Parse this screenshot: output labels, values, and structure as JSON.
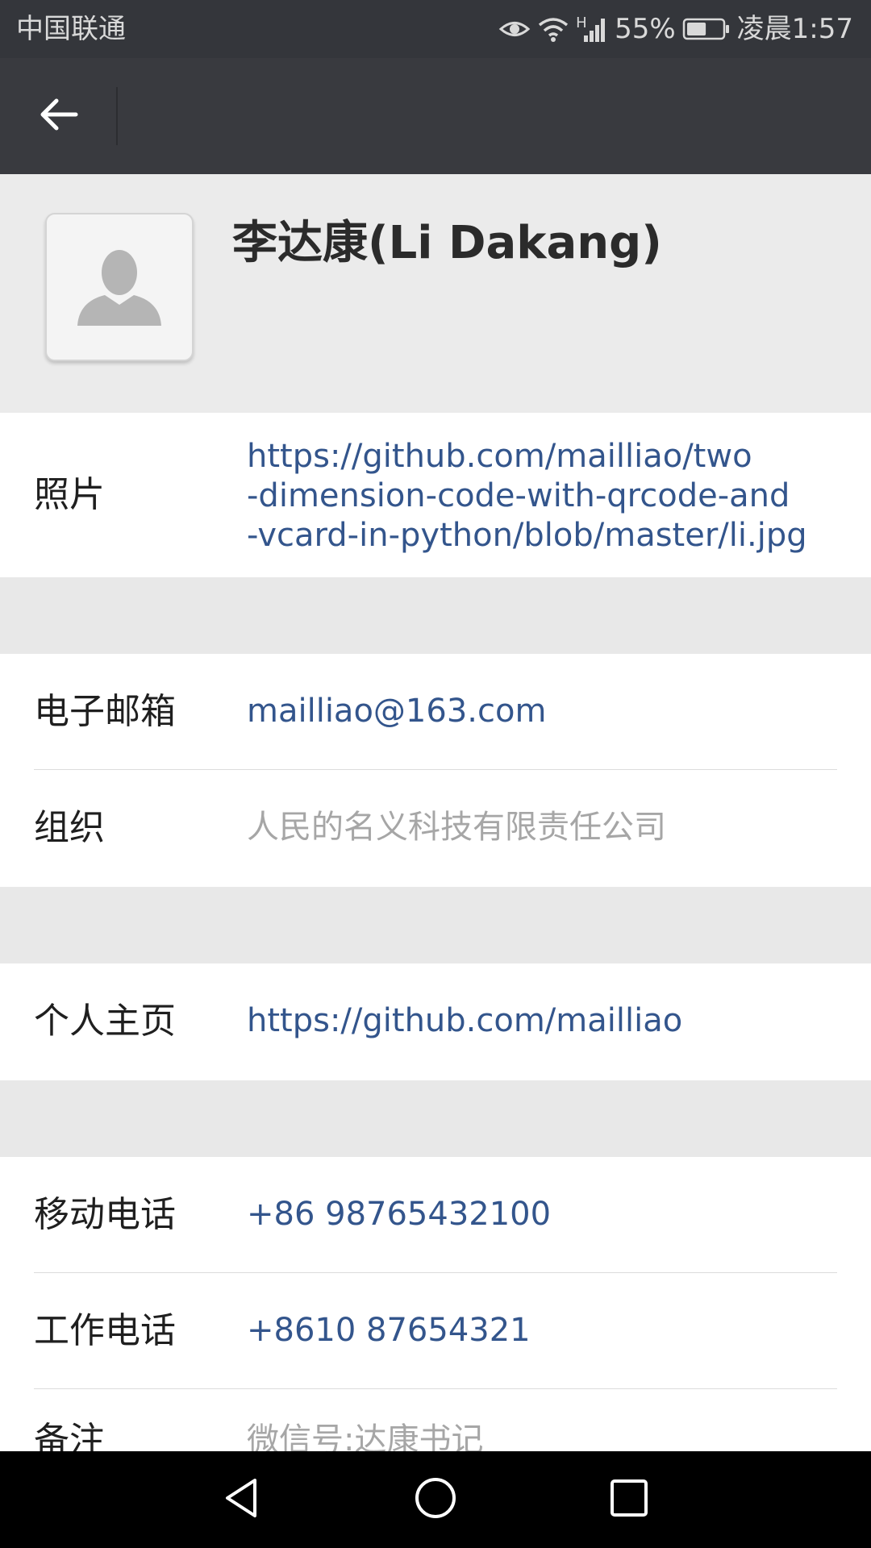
{
  "status_bar": {
    "carrier": "中国联通",
    "network_type": "H",
    "battery_percent": "55%",
    "time": "凌晨1:57",
    "icons": [
      "eye-icon",
      "wifi-icon",
      "signal-icon",
      "battery-icon"
    ],
    "battery_level": 0.55
  },
  "app_bar": {
    "back_icon": "arrow-left-icon"
  },
  "profile": {
    "name": "李达康(Li Dakang)",
    "avatar_icon": "person-silhouette-icon"
  },
  "photo": {
    "label": "照片",
    "value_lines": [
      "https://github.com/mailliao/two",
      "-dimension-code-with-qrcode-and",
      "-vcard-in-python/blob/master/li.jpg"
    ]
  },
  "contact": {
    "email_label": "电子邮箱",
    "email_value": "mailliao@163.com",
    "org_label": "组织",
    "org_value": "人民的名义科技有限责任公司"
  },
  "homepage": {
    "label": "个人主页",
    "value": "https://github.com/mailliao"
  },
  "phones": {
    "mobile_label": "移动电话",
    "mobile_value": "+86 98765432100",
    "work_label": "工作电话",
    "work_value": "+8610 87654321",
    "note_label": "备注",
    "note_value": "微信号:达康书记"
  },
  "nav_bar": {
    "icons": [
      "back-triangle-icon",
      "home-circle-icon",
      "recents-square-icon"
    ]
  },
  "colors": {
    "status_bar_bg": "#34363b",
    "app_bar_bg": "#393a3f",
    "page_bg": "#e8e8e8",
    "link": "#33558c",
    "muted_text": "#a6a6a6"
  }
}
